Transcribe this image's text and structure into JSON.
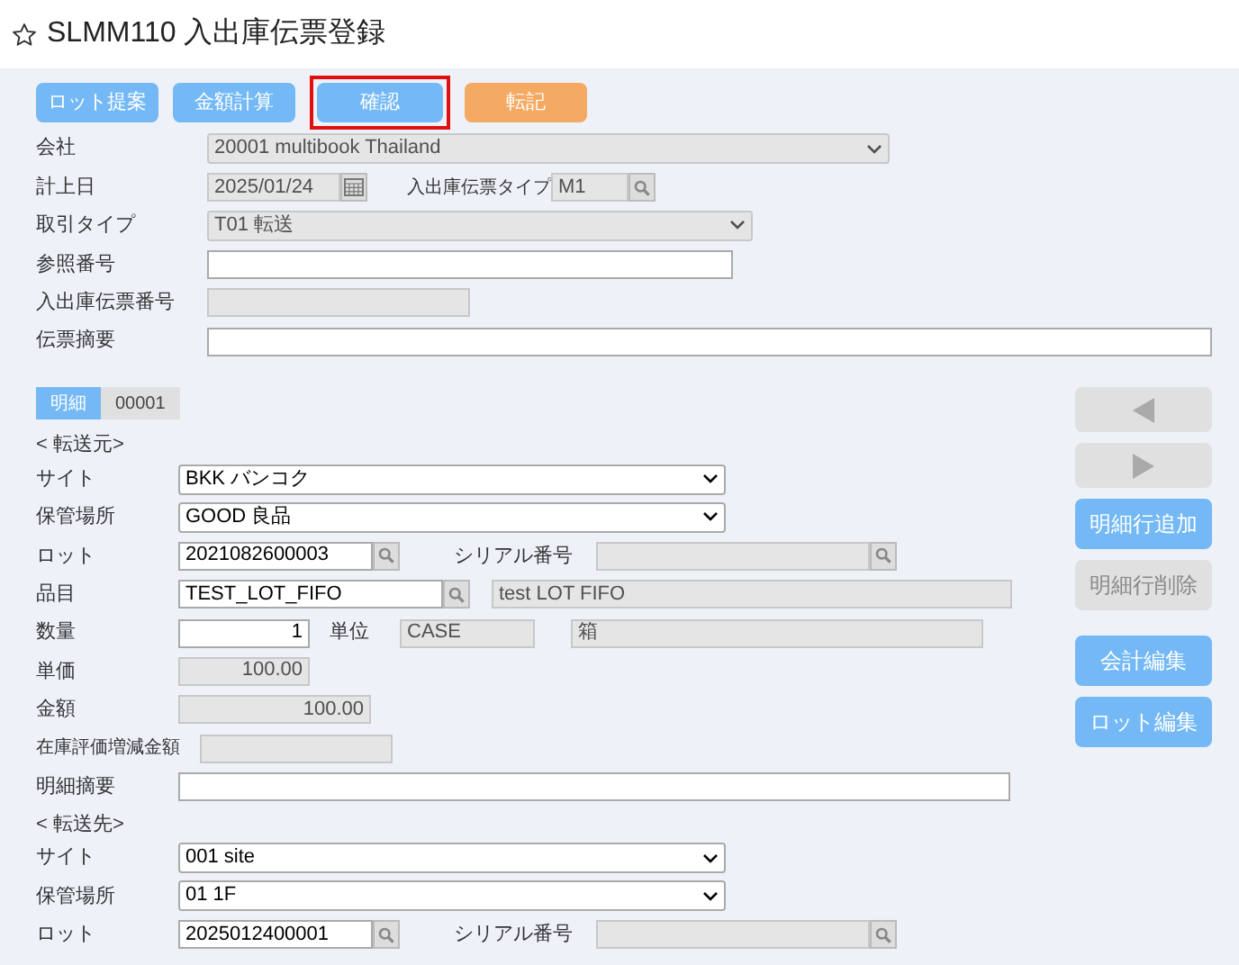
{
  "title": "SLMM110 入出庫伝票登録",
  "toolbar": [
    {
      "label": "ロット提案",
      "kind": "primary",
      "highlighted": false
    },
    {
      "label": "金額計算",
      "kind": "primary",
      "highlighted": false
    },
    {
      "label": "確認",
      "kind": "primary",
      "highlighted": true
    },
    {
      "label": "転記",
      "kind": "warning",
      "highlighted": false
    }
  ],
  "header": {
    "company": {
      "label": "会社",
      "value": "20001 multibook Thailand",
      "disabled": true
    },
    "posting_date": {
      "label": "計上日",
      "value": "2025/01/24",
      "disabled": true
    },
    "slip_type": {
      "label": "入出庫伝票タイプ",
      "value": "M1",
      "disabled": true
    },
    "transaction_type": {
      "label": "取引タイプ",
      "value": "T01 転送",
      "disabled": true
    },
    "reference_no": {
      "label": "参照番号",
      "disabled": false
    },
    "slip_no": {
      "label": "入出庫伝票番号",
      "disabled": true
    },
    "memo": {
      "label": "伝票摘要",
      "disabled": false
    }
  },
  "detail_tabs": [
    {
      "label": "明細",
      "selected": true
    },
    {
      "label": "00001",
      "selected": false
    }
  ],
  "source": {
    "heading": "< 転送元>",
    "site": {
      "label": "サイト",
      "value": "BKK バンコク",
      "disabled": false
    },
    "storage": {
      "label": "保管場所",
      "value": "GOOD 良品",
      "disabled": false
    },
    "lot": {
      "label": "ロット",
      "value": "2021082600003",
      "disabled": false
    },
    "serial": {
      "label": "シリアル番号",
      "disabled": true
    },
    "item": {
      "label": "品目",
      "value": "TEST_LOT_FIFO",
      "disabled": false
    },
    "item_name": {
      "value": "test LOT FIFO",
      "disabled": true
    },
    "quantity": {
      "label": "数量",
      "value": "1",
      "disabled": false
    },
    "unit": {
      "label": "単位",
      "value": "CASE",
      "disabled": true
    },
    "unit_name": {
      "value": "箱",
      "disabled": true
    },
    "unit_price": {
      "label": "単価",
      "value": "100.00",
      "disabled": true
    },
    "amount": {
      "label": "金額",
      "value": "100.00",
      "disabled": true
    },
    "valuation": {
      "label": "在庫評価増減金額",
      "disabled": true
    },
    "memo": {
      "label": "明細摘要",
      "disabled": false
    }
  },
  "destination": {
    "heading": "< 転送先>",
    "site": {
      "label": "サイト",
      "value": "001 site",
      "disabled": false
    },
    "storage": {
      "label": "保管場所",
      "value": "01 1F",
      "disabled": false
    },
    "lot": {
      "label": "ロット",
      "value": "2025012400001",
      "disabled": false
    },
    "serial": {
      "label": "シリアル番号",
      "disabled": true
    }
  },
  "side_buttons": [
    {
      "kind": "prev",
      "disabled": true
    },
    {
      "kind": "next",
      "disabled": true
    },
    {
      "kind": "text",
      "label": "明細行追加",
      "disabled": false
    },
    {
      "kind": "text",
      "label": "明細行削除",
      "disabled": true
    },
    {
      "kind": "text",
      "label": "会計編集",
      "disabled": false
    },
    {
      "kind": "text",
      "label": "ロット編集",
      "disabled": false
    }
  ]
}
